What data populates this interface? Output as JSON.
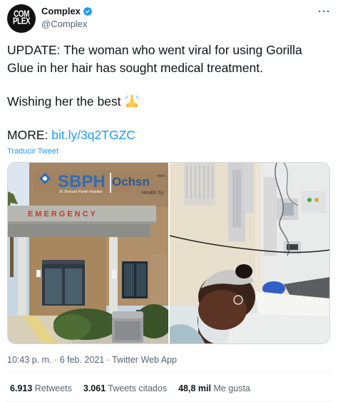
{
  "author": {
    "display_name": "Complex",
    "handle": "@Complex",
    "avatar_text_top": "COM",
    "avatar_text_bottom": "PLEX"
  },
  "more_menu": "···",
  "tweet": {
    "line1": "UPDATE: The woman who went viral for using Gorilla Glue in her hair has sought medical treatment.",
    "line2": "Wishing her the best",
    "line3_prefix": "MORE: ",
    "link_text": "bit.ly/3q2TGZC"
  },
  "translate_label": "Traducir Tweet",
  "media": {
    "left": {
      "sign_main": "SBPH",
      "sign_secondary": "Ochsn",
      "sign_sub": "St. Bernard Parish Hospital",
      "sign_small_top": "Mem",
      "sign_small_bottom": "Health Sy",
      "emergency": "EMERGENCY"
    },
    "right": {}
  },
  "meta": {
    "time": "10:43 p. m.",
    "date": "6 feb. 2021",
    "source": "Twitter Web App",
    "separator": "·"
  },
  "stats": {
    "retweets_count": "6.913",
    "retweets_label": "Retweets",
    "quotes_count": "3.061",
    "quotes_label": "Tweets citados",
    "likes_count": "48,8 mil",
    "likes_label": "Me gusta"
  },
  "colors": {
    "accent": "#1d9bf0",
    "text": "#0f1419",
    "muted": "#536471"
  }
}
